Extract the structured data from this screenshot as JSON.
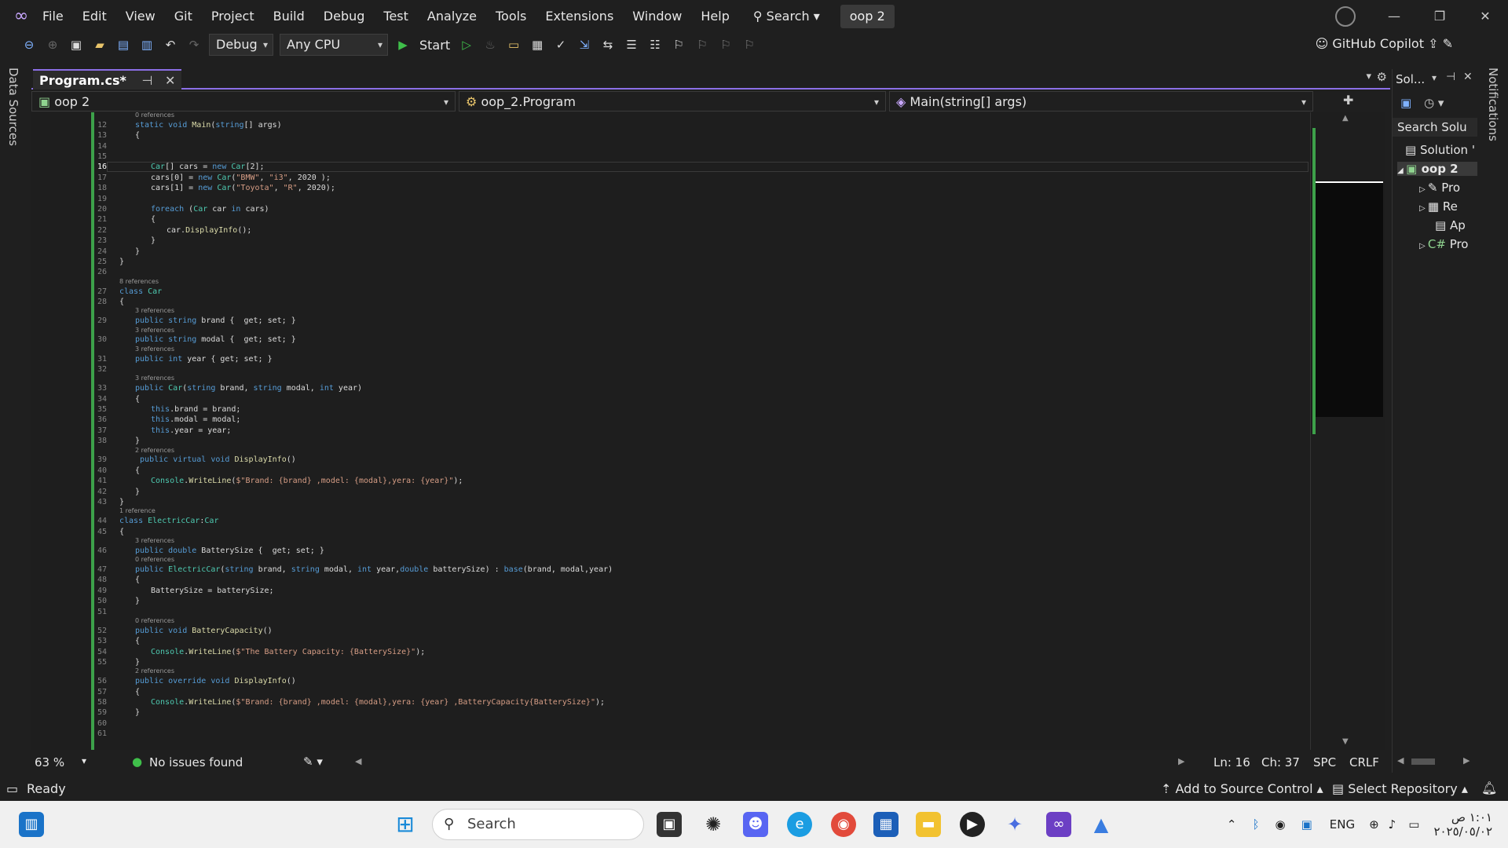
{
  "menu": [
    "File",
    "Edit",
    "View",
    "Git",
    "Project",
    "Build",
    "Debug",
    "Test",
    "Analyze",
    "Tools",
    "Extensions",
    "Window",
    "Help"
  ],
  "search_label": "Search",
  "project_badge": "oop 2",
  "toolbar": {
    "config": "Debug",
    "platform": "Any CPU",
    "start": "Start",
    "copilot": "GitHub Copilot"
  },
  "left_tab": "Data Sources",
  "right_tab": "Notifications",
  "doc_tab": "Program.cs*",
  "nav": {
    "project": "oop 2",
    "class": "oop_2.Program",
    "member": "Main(string[] args)"
  },
  "code_lines": [
    {
      "n": "12",
      "t": "static void Main(string[] args)",
      "i": 1
    },
    {
      "n": "13",
      "t": "{",
      "i": 1
    },
    {
      "n": "14",
      "t": "",
      "i": 0
    },
    {
      "n": "15",
      "t": "",
      "i": 0
    },
    {
      "n": "16",
      "t": "Car[] cars = new Car[2];",
      "i": 2
    },
    {
      "n": "17",
      "t": "cars[0] = new Car(\"BMW\", \"i3\", 2020 );",
      "i": 2
    },
    {
      "n": "18",
      "t": "cars[1] = new Car(\"Toyota\", \"R\", 2020);",
      "i": 2
    },
    {
      "n": "19",
      "t": "",
      "i": 0
    },
    {
      "n": "20",
      "t": "foreach (Car car in cars)",
      "i": 2
    },
    {
      "n": "21",
      "t": "{",
      "i": 2
    },
    {
      "n": "22",
      "t": "car.DisplayInfo();",
      "i": 3
    },
    {
      "n": "23",
      "t": "}",
      "i": 2
    },
    {
      "n": "24",
      "t": "}",
      "i": 1
    },
    {
      "n": "25",
      "t": "}",
      "i": 0
    },
    {
      "n": "26",
      "t": "",
      "i": 0
    },
    {
      "n": "27",
      "t": "class Car",
      "i": 0
    },
    {
      "n": "28",
      "t": "{",
      "i": 0
    },
    {
      "n": "29",
      "t": "public string brand {  get; set; }",
      "i": 1
    },
    {
      "n": "30",
      "t": "public string modal {  get; set; }",
      "i": 1
    },
    {
      "n": "31",
      "t": "public int year { get; set; }",
      "i": 1
    },
    {
      "n": "32",
      "t": "",
      "i": 0
    },
    {
      "n": "33",
      "t": "public Car(string brand, string modal, int year)",
      "i": 1
    },
    {
      "n": "34",
      "t": "{",
      "i": 1
    },
    {
      "n": "35",
      "t": "this.brand = brand;",
      "i": 2
    },
    {
      "n": "36",
      "t": "this.modal = modal;",
      "i": 2
    },
    {
      "n": "37",
      "t": "this.year = year;",
      "i": 2
    },
    {
      "n": "38",
      "t": "}",
      "i": 1
    },
    {
      "n": "39",
      "t": " public virtual void DisplayInfo()",
      "i": 1
    },
    {
      "n": "40",
      "t": "{",
      "i": 1
    },
    {
      "n": "41",
      "t": "Console.WriteLine($\"Brand: {brand} ,model: {modal},yera: {year}\");",
      "i": 2
    },
    {
      "n": "42",
      "t": "}",
      "i": 1
    },
    {
      "n": "43",
      "t": "}",
      "i": 0
    },
    {
      "n": "44",
      "t": "class ElectricCar:Car",
      "i": 0
    },
    {
      "n": "45",
      "t": "{",
      "i": 0
    },
    {
      "n": "46",
      "t": "public double BatterySize {  get; set; }",
      "i": 1
    },
    {
      "n": "47",
      "t": "public ElectricCar(string brand, string modal, int year,double batterySize) : base(brand, modal,year)",
      "i": 1
    },
    {
      "n": "48",
      "t": "{",
      "i": 1
    },
    {
      "n": "49",
      "t": "BatterySize = batterySize;",
      "i": 2
    },
    {
      "n": "50",
      "t": "}",
      "i": 1
    },
    {
      "n": "51",
      "t": "",
      "i": 0
    },
    {
      "n": "52",
      "t": "public void BatteryCapacity()",
      "i": 1
    },
    {
      "n": "53",
      "t": "{",
      "i": 1
    },
    {
      "n": "54",
      "t": "Console.WriteLine($\"The Battery Capacity: {BatterySize}\");",
      "i": 2
    },
    {
      "n": "55",
      "t": "}",
      "i": 1
    },
    {
      "n": "56",
      "t": "public override void DisplayInfo()",
      "i": 1
    },
    {
      "n": "57",
      "t": "{",
      "i": 1
    },
    {
      "n": "58",
      "t": "Console.WriteLine($\"Brand: {brand} ,model: {modal},yera: {year} ,BatteryCapacity{BatterySize}\");",
      "i": 2
    },
    {
      "n": "59",
      "t": "}",
      "i": 1
    },
    {
      "n": "60",
      "t": "",
      "i": 0
    },
    {
      "n": "61",
      "t": "",
      "i": 0
    }
  ],
  "references": [
    {
      "before": "12",
      "text": "0 references",
      "i": 1
    },
    {
      "before": "27",
      "text": "8 references",
      "i": 0
    },
    {
      "before": "29",
      "text": "3 references",
      "i": 1
    },
    {
      "before": "30",
      "text": "3 references",
      "i": 1
    },
    {
      "before": "31",
      "text": "3 references",
      "i": 1
    },
    {
      "before": "33",
      "text": "3 references",
      "i": 1
    },
    {
      "before": "39",
      "text": "2 references",
      "i": 1
    },
    {
      "before": "44",
      "text": "1 reference",
      "i": 0
    },
    {
      "before": "46",
      "text": "3 references",
      "i": 1
    },
    {
      "before": "47",
      "text": "0 references",
      "i": 1
    },
    {
      "before": "52",
      "text": "0 references",
      "i": 1
    },
    {
      "before": "56",
      "text": "2 references",
      "i": 1
    }
  ],
  "current_line": "16",
  "editor_status": {
    "zoom": "63 %",
    "issues": "No issues found",
    "ln": "Ln: 16",
    "ch": "Ch: 37",
    "spc": "SPC",
    "crlf": "CRLF"
  },
  "solution": {
    "title": "Sol...",
    "search": "Search Solu",
    "items": [
      "Solution '",
      "oop 2",
      "Pro",
      "Re",
      "Ap",
      "Pro"
    ]
  },
  "statusbar": {
    "ready": "Ready",
    "source_control": "Add to Source Control",
    "repo": "Select Repository"
  },
  "taskbar": {
    "search": "Search",
    "lang": "ENG",
    "time": "١:٠١ ص",
    "date": "٢٠٢٥/٠٥/٠٢"
  }
}
